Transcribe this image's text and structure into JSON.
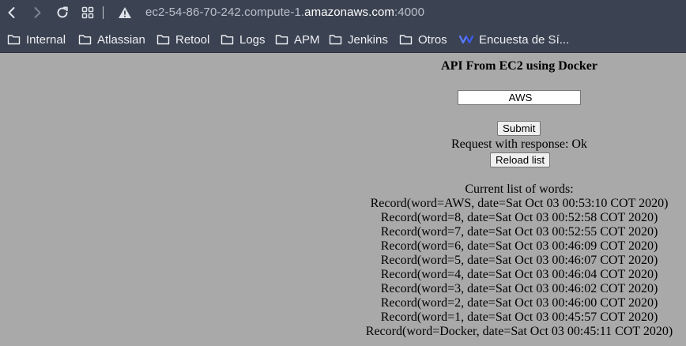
{
  "browser": {
    "url_prefix": "ec2-54-86-70-242.compute-1.",
    "url_host": "amazonaws.com",
    "url_suffix": ":4000",
    "bookmarks": [
      "Internal",
      "Atlassian",
      "Retool",
      "Logs",
      "APM",
      "Jenkins",
      "Otros",
      "Encuesta de Sí..."
    ]
  },
  "page": {
    "title": "API From EC2 using Docker",
    "input_value": "AWS",
    "submit_label": "Submit",
    "response_text": "Request with response: Ok",
    "reload_label": "Reload list",
    "list_title": "Current list of words:",
    "records": [
      "Record(word=AWS, date=Sat Oct 03 00:53:10 COT 2020)",
      "Record(word=8, date=Sat Oct 03 00:52:58 COT 2020)",
      "Record(word=7, date=Sat Oct 03 00:52:55 COT 2020)",
      "Record(word=6, date=Sat Oct 03 00:46:09 COT 2020)",
      "Record(word=5, date=Sat Oct 03 00:46:07 COT 2020)",
      "Record(word=4, date=Sat Oct 03 00:46:04 COT 2020)",
      "Record(word=3, date=Sat Oct 03 00:46:02 COT 2020)",
      "Record(word=2, date=Sat Oct 03 00:46:00 COT 2020)",
      "Record(word=1, date=Sat Oct 03 00:45:57 COT 2020)",
      "Record(word=Docker, date=Sat Oct 03 00:45:11 COT 2020)"
    ]
  },
  "colors": {
    "chrome_bg": "#3b4251",
    "page_bg": "#a9a9a9"
  }
}
